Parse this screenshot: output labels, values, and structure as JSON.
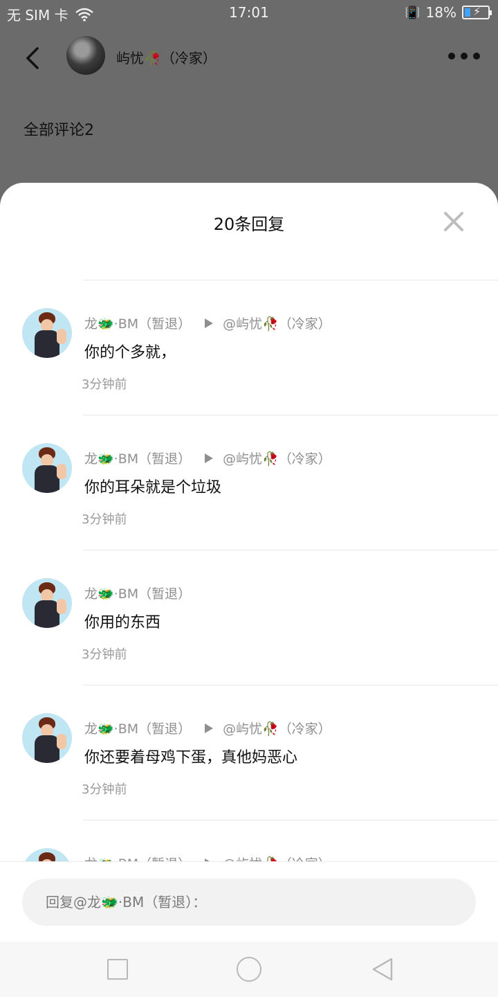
{
  "status_bar": {
    "carrier": "无 SIM 卡",
    "time": "17:01",
    "battery_percent": "18%"
  },
  "header": {
    "title": "屿忧🥀（冷家）"
  },
  "background": {
    "comments_title": "全部评论2"
  },
  "sheet": {
    "title": "20条回复",
    "close_icon": "close-icon"
  },
  "replies": [
    {
      "author": "龙🐲·BM（暂退）",
      "reply_to": "@屿忧🥀（冷家）",
      "text": "你的个多就，",
      "time": "3分钟前"
    },
    {
      "author": "龙🐲·BM（暂退）",
      "reply_to": "@屿忧🥀（冷家）",
      "text": "你的耳朵就是个垃圾",
      "time": "3分钟前"
    },
    {
      "author": "龙🐲·BM（暂退）",
      "reply_to": "",
      "text": "你用的东西",
      "time": "3分钟前"
    },
    {
      "author": "龙🐲·BM（暂退）",
      "reply_to": "@屿忧🥀（冷家）",
      "text": "你还要着母鸡下蛋，真他妈恶心",
      "time": "3分钟前"
    },
    {
      "author": "龙🐲·BM（暂退）",
      "reply_to": "@屿忧🥀（冷家）",
      "text": "",
      "time": ""
    }
  ],
  "reply_bar": {
    "placeholder": "回复@龙🐲·BM（暂退）："
  },
  "colors": {
    "overlay": "#6b6b6b",
    "sheet": "#ffffff",
    "muted_text": "#8f8f8f",
    "battery_accent": "#3fa3ff"
  }
}
